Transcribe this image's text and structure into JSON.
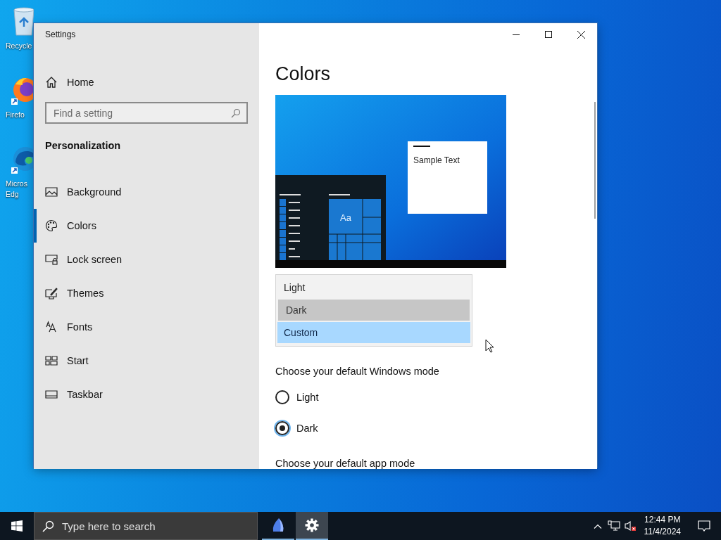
{
  "desktop": {
    "icons": [
      {
        "kind": "recycle",
        "lines": [
          "Recycle"
        ]
      },
      {
        "kind": "firefox",
        "lines": [
          "Firefo"
        ]
      },
      {
        "kind": "edge",
        "lines": [
          "Micros",
          "Edg"
        ]
      }
    ]
  },
  "window": {
    "title": "Settings"
  },
  "sidebar": {
    "home": "Home",
    "search": {
      "placeholder": "Find a setting"
    },
    "section": "Personalization",
    "items": [
      {
        "label": "Background",
        "kind": "picture",
        "selected": false
      },
      {
        "label": "Colors",
        "kind": "palette",
        "selected": true
      },
      {
        "label": "Lock screen",
        "kind": "lock",
        "selected": false
      },
      {
        "label": "Themes",
        "kind": "brush",
        "selected": false
      },
      {
        "label": "Fonts",
        "kind": "fonts",
        "selected": false
      },
      {
        "label": "Start",
        "kind": "start",
        "selected": false
      },
      {
        "label": "Taskbar",
        "kind": "taskbar",
        "selected": false
      }
    ]
  },
  "content": {
    "heading": "Colors",
    "preview": {
      "sample_text": "Sample Text",
      "tile_text": "Aa"
    },
    "color_dropdown": {
      "options": [
        {
          "label": "Light",
          "selected": false,
          "hovered": false
        },
        {
          "label": "Dark",
          "selected": false,
          "hovered": true
        },
        {
          "label": "Custom",
          "selected": true,
          "hovered": false
        }
      ]
    },
    "windows_mode": {
      "label": "Choose your default Windows mode",
      "options": [
        {
          "label": "Light",
          "selected": false
        },
        {
          "label": "Dark",
          "selected": true
        }
      ]
    },
    "app_mode": {
      "label": "Choose your default app mode"
    }
  },
  "taskbar": {
    "search": {
      "placeholder": "Type here to search"
    },
    "apps": [
      {
        "kind": "sail",
        "active": false
      },
      {
        "kind": "settings",
        "active": true
      }
    ],
    "clock": {
      "time": "12:44 PM",
      "date": "11/4/2024"
    }
  }
}
